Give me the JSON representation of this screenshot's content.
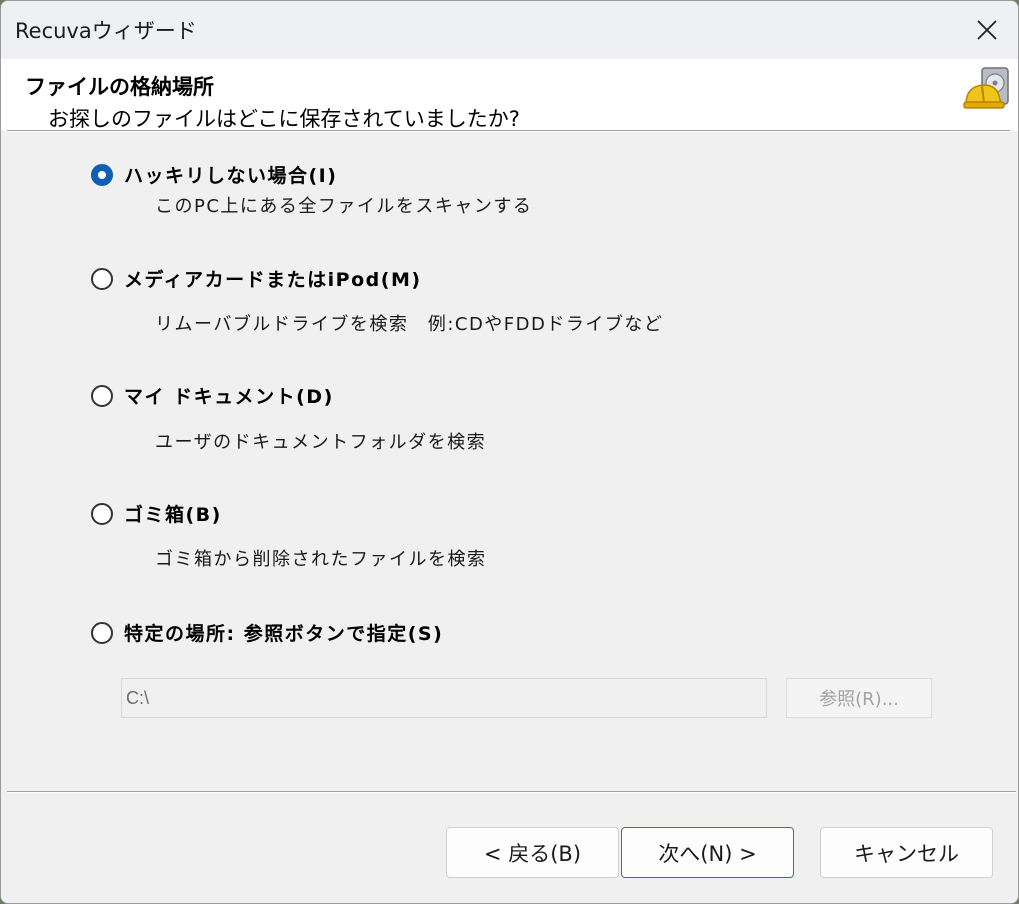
{
  "window": {
    "title": "Recuvaウィザード"
  },
  "header": {
    "title": "ファイルの格納場所",
    "subtitle": "お探しのファイルはどこに保存されていましたか?"
  },
  "options": [
    {
      "label": "ハッキリしない場合(I)",
      "description": "このPC上にある全ファイルをスキャンする",
      "checked": true
    },
    {
      "label": "メディアカードまたはiPod(M)",
      "description": "リムーバブルドライブを検索　例:CDやFDDドライブなど",
      "checked": false
    },
    {
      "label": "マイ ドキュメント(D)",
      "description": "ユーザのドキュメントフォルダを検索",
      "checked": false
    },
    {
      "label": "ゴミ箱(B)",
      "description": "ゴミ箱から削除されたファイルを検索",
      "checked": false
    },
    {
      "label": "特定の場所: 参照ボタンで指定(S)",
      "description": "",
      "checked": false
    }
  ],
  "location": {
    "path_value": "C:\\",
    "browse_label": "参照(R)..."
  },
  "buttons": {
    "back_label": "< 戻る(B)",
    "next_label": "次へ(N) >",
    "cancel_label": "キャンセル"
  },
  "colors": {
    "accent": "#0f5fb5",
    "default_button_border": "#2f6fb7"
  },
  "icons": {
    "close": "close-icon",
    "header": "recuva-hardhat-disk-icon"
  }
}
